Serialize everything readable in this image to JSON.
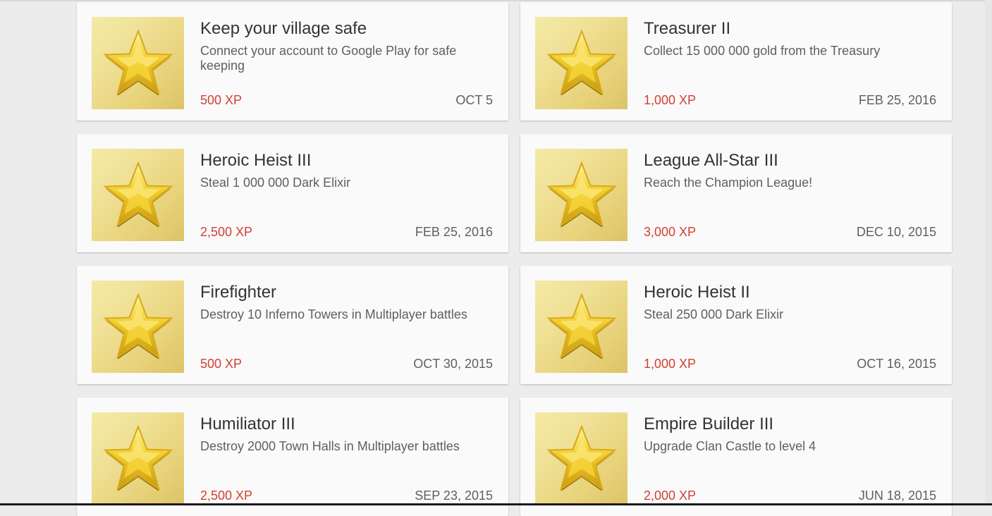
{
  "achievements": [
    {
      "title": "Keep your village safe",
      "description": "Connect your account to Google Play for safe keeping",
      "xp": "500 XP",
      "date": "OCT 5",
      "icon": "gold-star-icon"
    },
    {
      "title": "Treasurer II",
      "description": "Collect 15 000 000 gold from the Treasury",
      "xp": "1,000 XP",
      "date": "FEB 25, 2016",
      "icon": "gold-star-icon"
    },
    {
      "title": "Heroic Heist III",
      "description": "Steal 1 000 000 Dark Elixir",
      "xp": "2,500 XP",
      "date": "FEB 25, 2016",
      "icon": "gold-star-icon"
    },
    {
      "title": "League All-Star III",
      "description": "Reach the Champion League!",
      "xp": "3,000 XP",
      "date": "DEC 10, 2015",
      "icon": "gold-star-icon"
    },
    {
      "title": "Firefighter",
      "description": "Destroy 10 Inferno Towers in Multiplayer battles",
      "xp": "500 XP",
      "date": "OCT 30, 2015",
      "icon": "gold-star-icon"
    },
    {
      "title": "Heroic Heist II",
      "description": "Steal 250 000 Dark Elixir",
      "xp": "1,000 XP",
      "date": "OCT 16, 2015",
      "icon": "gold-star-icon"
    },
    {
      "title": "Humiliator III",
      "description": "Destroy 2000 Town Halls in Multiplayer battles",
      "xp": "2,500 XP",
      "date": "SEP 23, 2015",
      "icon": "gold-star-icon"
    },
    {
      "title": "Empire Builder III",
      "description": "Upgrade Clan Castle to level 4",
      "xp": "2,000 XP",
      "date": "JUN 18, 2015",
      "icon": "gold-star-icon"
    }
  ],
  "colors": {
    "xp_text": "#d23f31",
    "card_background": "#fafafa",
    "page_background": "#ececec"
  }
}
